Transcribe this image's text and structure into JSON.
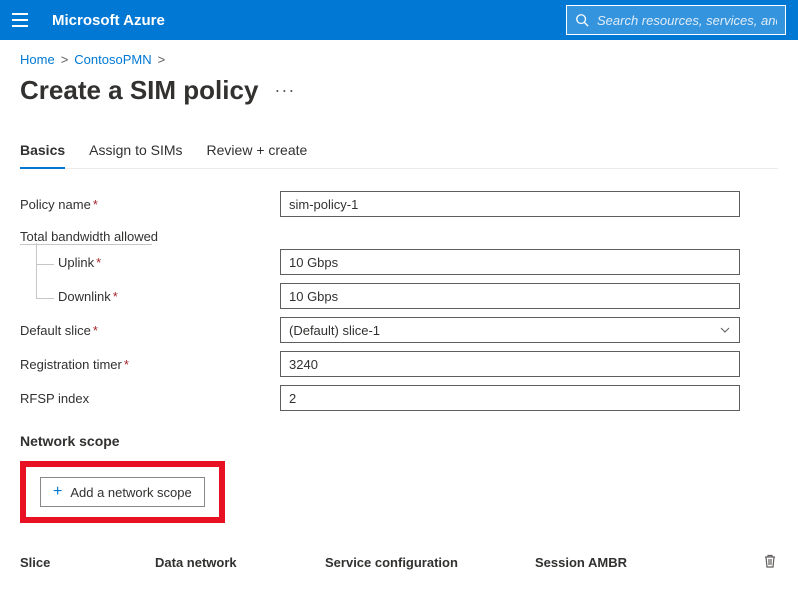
{
  "header": {
    "brand": "Microsoft Azure",
    "search_placeholder": "Search resources, services, and docs"
  },
  "breadcrumb": {
    "home": "Home",
    "parent": "ContosoPMN"
  },
  "page": {
    "title": "Create a SIM policy"
  },
  "tabs": {
    "basics": "Basics",
    "assign": "Assign to SIMs",
    "review": "Review + create"
  },
  "form": {
    "policy_name_label": "Policy name",
    "policy_name_value": "sim-policy-1",
    "bandwidth_label": "Total bandwidth allowed",
    "uplink_label": "Uplink",
    "uplink_value": "10 Gbps",
    "downlink_label": "Downlink",
    "downlink_value": "10 Gbps",
    "default_slice_label": "Default slice",
    "default_slice_value": "(Default) slice-1",
    "reg_timer_label": "Registration timer",
    "reg_timer_value": "3240",
    "rfsp_label": "RFSP index",
    "rfsp_value": "2"
  },
  "network_scope": {
    "title": "Network scope",
    "add_button": "Add a network scope",
    "columns": {
      "slice": "Slice",
      "data_network": "Data network",
      "service_config": "Service configuration",
      "session_ambr": "Session AMBR"
    }
  }
}
